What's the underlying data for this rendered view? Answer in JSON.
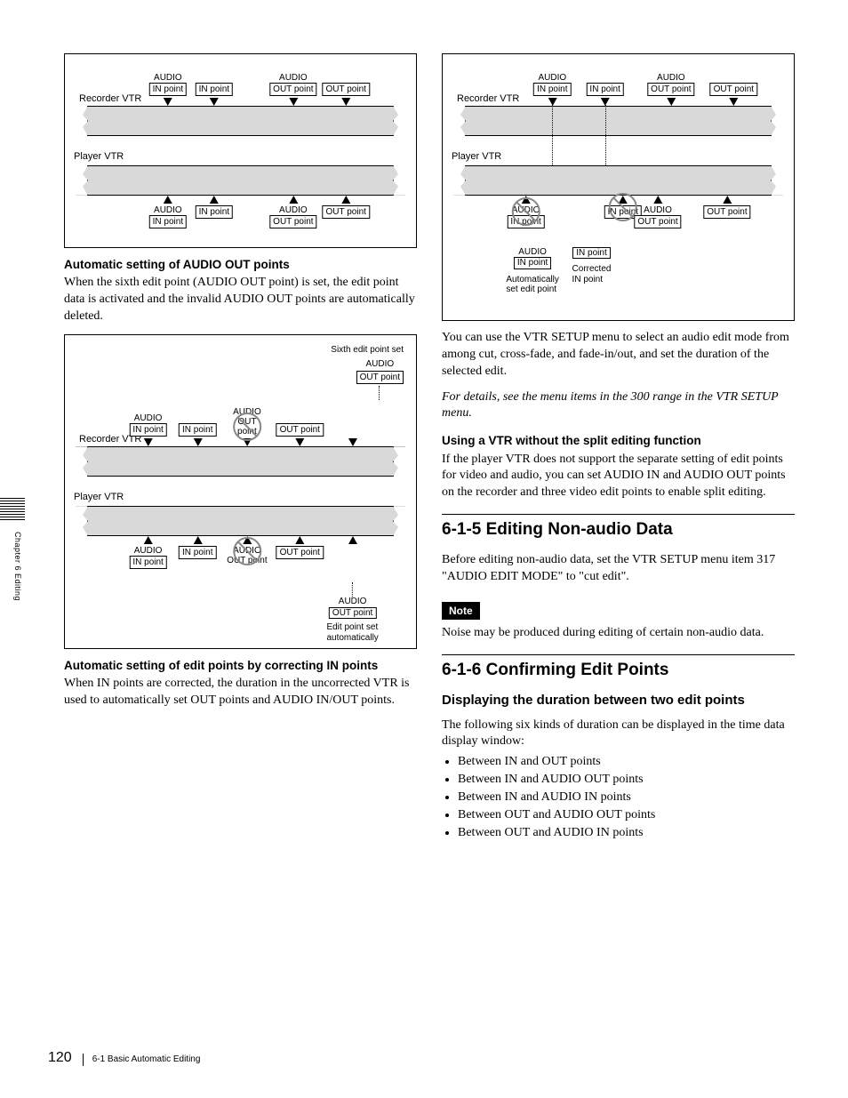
{
  "sidecap": "Chapter 6  Editing",
  "footer": {
    "page": "120",
    "title": "6-1 Basic Automatic Editing"
  },
  "labels": {
    "recorder": "Recorder VTR",
    "player": "Player VTR",
    "audio_in": "AUDIO\nIN point",
    "audio_out": "AUDIO\nOUT point",
    "in": "IN point",
    "out": "OUT point",
    "audio_in_box": "AUDIO IN point",
    "audio_out_box": "AUDIO OUT point"
  },
  "left": {
    "sub1": "Automatic setting of AUDIO OUT points",
    "p1": "When the sixth edit point (AUDIO OUT point) is set, the edit point data is activated and the invalid AUDIO OUT points are automatically deleted.",
    "sixth": "Sixth edit point set",
    "edit_auto": "Edit point set\nautomatically",
    "sub2": "Automatic setting of edit points by correcting IN points",
    "p2": "When IN points are corrected, the duration in the uncorrected VTR is used to automatically set OUT points and AUDIO IN/OUT points."
  },
  "right": {
    "auto_set": "Automatically\nset edit point",
    "corrected": "Corrected\nIN point",
    "p1": "You can use the VTR SETUP menu to select an audio edit mode from among cut, cross-fade, and fade-in/out, and set the duration of the selected edit.",
    "ital": "For details, see the menu items in the 300 range in the VTR SETUP menu.",
    "sub1": "Using a VTR without the split editing function",
    "p2": "If the player VTR does not support the separate setting of edit points for video and audio, you can set AUDIO IN and AUDIO OUT points on the recorder and three video edit points to enable split editing.",
    "sec615": "6-1-5  Editing Non-audio Data",
    "p3": "Before editing non-audio data, set the VTR SETUP menu item 317 \"AUDIO EDIT MODE\" to \"cut edit\".",
    "note": "Note",
    "p4": "Noise may be produced during editing of certain non-audio data.",
    "sec616": "6-1-6  Confirming Edit Points",
    "sub2": "Displaying the duration between two edit points",
    "p5": "The following six kinds of duration can be displayed in the time data display window:",
    "bullets": [
      "Between IN and OUT points",
      "Between IN and AUDIO OUT points",
      "Between IN and AUDIO IN points",
      "Between OUT and AUDIO OUT points",
      "Between OUT and AUDIO IN points"
    ]
  }
}
